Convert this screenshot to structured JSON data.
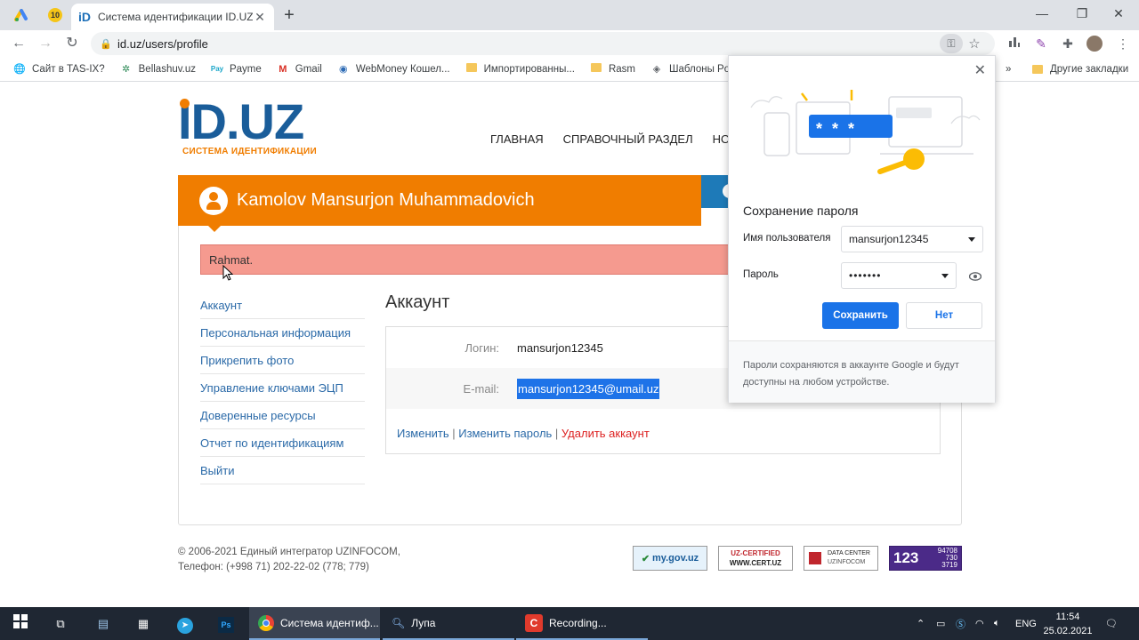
{
  "browser": {
    "pinned_tab_badge": "10",
    "tab_title": "Система идентификации ID.UZ",
    "url": "id.uz/users/profile",
    "bookmarks": [
      {
        "label": "Сайт в TAS-IX?",
        "icon": "globe-icon"
      },
      {
        "label": "Bellashuv.uz",
        "icon": "palm-icon"
      },
      {
        "label": "Payme",
        "icon": "payme-icon"
      },
      {
        "label": "Gmail",
        "icon": "gmail-icon"
      },
      {
        "label": "WebMoney Кошел...",
        "icon": "webmoney-icon"
      },
      {
        "label": "Импортированны...",
        "icon": "folder-icon"
      },
      {
        "label": "Rasm",
        "icon": "folder-icon"
      },
      {
        "label": "Шаблоны Powe",
        "icon": "template-icon"
      }
    ],
    "other_bookmarks": "Другие закладки"
  },
  "site": {
    "logo_text": "ID.UZ",
    "logo_sub": "СИСТЕМА ИДЕНТИФИКАЦИИ",
    "nav": [
      "ГЛАВНАЯ",
      "СПРАВОЧНЫЙ РАЗДЕЛ",
      "НОВО"
    ],
    "user_name": "Kamolov Mansurjon Muhammadovich",
    "alert": "Rahmat.",
    "sidebar": [
      "Аккаунт",
      "Персональная информация",
      "Прикрепить фото",
      "Управление ключами ЭЦП",
      "Доверенные ресурсы",
      "Отчет по идентификациям",
      "Выйти"
    ],
    "account": {
      "title": "Аккаунт",
      "login_label": "Логин:",
      "login_value": "mansurjon12345",
      "email_label": "E-mail:",
      "email_value": "mansurjon12345@umail.uz",
      "link_edit": "Изменить",
      "link_password": "Изменить пароль",
      "link_delete": "Удалить аккаунт",
      "separator": " | "
    },
    "footer": {
      "line1": "© 2006-2021 Единый интегратор UZINFOCOM,",
      "line2": "Телефон: (+998 71) 202-22-02 (778; 779)"
    },
    "badges": {
      "mygov": "my.gov.uz",
      "cert_top": "UZ-CERTIFIED",
      "cert_bottom": "WWW.CERT.UZ",
      "dc_top": "DATA CENTER",
      "dc_bottom": "UZINFOCOM",
      "counter_big": "123",
      "counter_1": "94708",
      "counter_2": "730",
      "counter_3": "3719"
    }
  },
  "popup": {
    "title": "Сохранение пароля",
    "username_label": "Имя пользователя",
    "username_value": "mansurjon12345",
    "password_label": "Пароль",
    "password_value": "•••••••",
    "illustration_stars": "* * *",
    "save_button": "Сохранить",
    "no_button": "Нет",
    "footer_text": "Пароли сохраняются в аккаунте Google и будут доступны на любом устройстве."
  },
  "taskbar": {
    "apps": [
      {
        "label": "Система идентиф..."
      },
      {
        "label": "Лупа"
      },
      {
        "label": "Recording..."
      }
    ],
    "lang": "ENG",
    "time": "11:54",
    "date": "25.02.2021"
  },
  "colors": {
    "orange": "#f07d00",
    "brand_blue": "#1a5d9a",
    "link_blue": "#2b6aa8",
    "google_blue": "#1a73e8",
    "alert_bg": "#f59a8f"
  }
}
